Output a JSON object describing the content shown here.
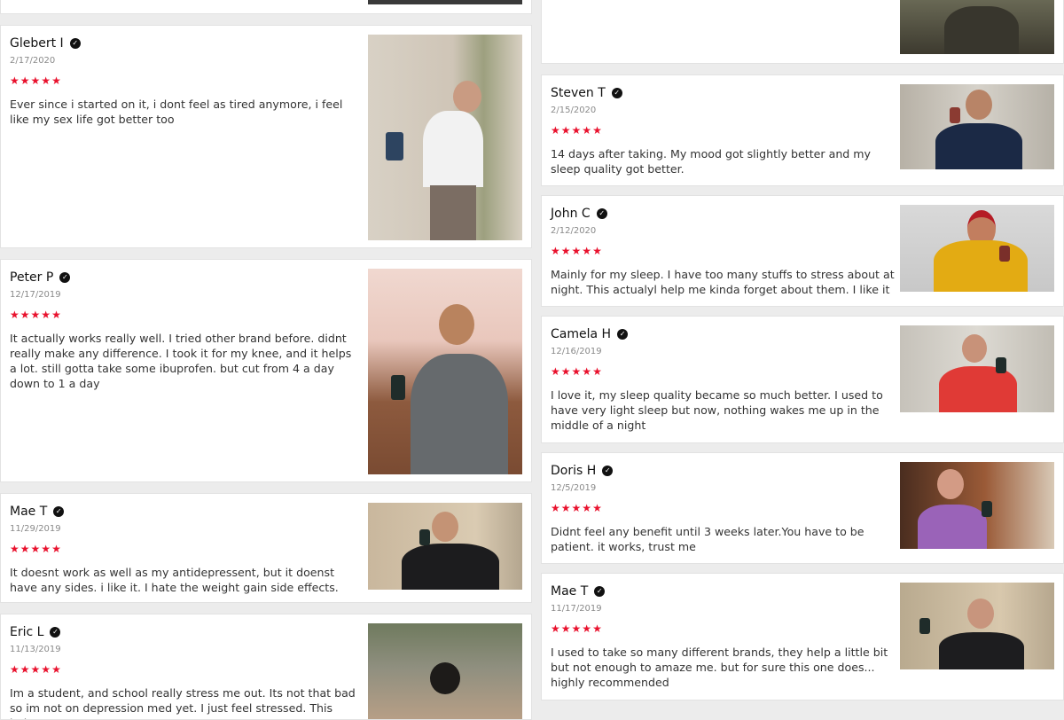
{
  "reviews": [
    {
      "name": "Glebert I",
      "date": "2/17/2020",
      "rating": 5,
      "text": "Ever since i started on it, i dont feel as tired anymore, i feel like my sex life got better too",
      "photo": "person-holding-supplement-jar"
    },
    {
      "name": "Peter P",
      "date": "12/17/2019",
      "rating": 5,
      "text": "It actually works really well. I tried other brand before. didnt really make any difference. I took it for my knee, and it helps a lot. still gotta take some ibuprofen. but cut from 4 a day down to 1 a day",
      "photo": "person-holding-supplement-jar"
    },
    {
      "name": "Mae T",
      "date": "11/29/2019",
      "rating": 5,
      "text": "It doesnt work as well as my antidepressent, but it doenst have any sides. i like it. I hate the weight gain side effects.",
      "photo": "person-holding-supplement-jar"
    },
    {
      "name": "Eric L",
      "date": "11/13/2019",
      "rating": 5,
      "text": "Im a student, and school really stress me out. Its not that bad so im not on depression med yet. I just feel stressed. This helps",
      "photo": "person-holding-supplement-jar"
    },
    {
      "name": "Steven T",
      "date": "2/15/2020",
      "rating": 5,
      "text": "14 days after taking. My mood got slightly better and my sleep quality got better.",
      "photo": "person-holding-supplement-jar"
    },
    {
      "name": "John C",
      "date": "2/12/2020",
      "rating": 5,
      "text": "Mainly for my sleep. I have too many stuffs to stress about at night. This actualyl help me kinda forget about them. I like it",
      "photo": "person-holding-supplement-jar"
    },
    {
      "name": "Camela H",
      "date": "12/16/2019",
      "rating": 5,
      "text": "I love it, my sleep quality became so much better. I used to have very light sleep but now, nothing wakes me up in the middle of a night",
      "photo": "person-holding-supplement-jar"
    },
    {
      "name": "Doris H",
      "date": "12/5/2019",
      "rating": 5,
      "text": "Didnt feel any benefit until 3 weeks later.You have to be patient. it works, trust me",
      "photo": "person-holding-supplement-jar"
    },
    {
      "name": "Mae T",
      "date": "11/17/2019",
      "rating": 5,
      "text": "I used to take so many different brands, they help a little bit but not enough to amaze me. but for sure this one does... highly recommended",
      "photo": "person-holding-supplement-jar"
    }
  ],
  "colors": {
    "star": "#e9112d",
    "verified": "#111111",
    "background": "#ececec"
  },
  "icons": {
    "verified": "check-circle-icon",
    "star": "star-icon"
  }
}
